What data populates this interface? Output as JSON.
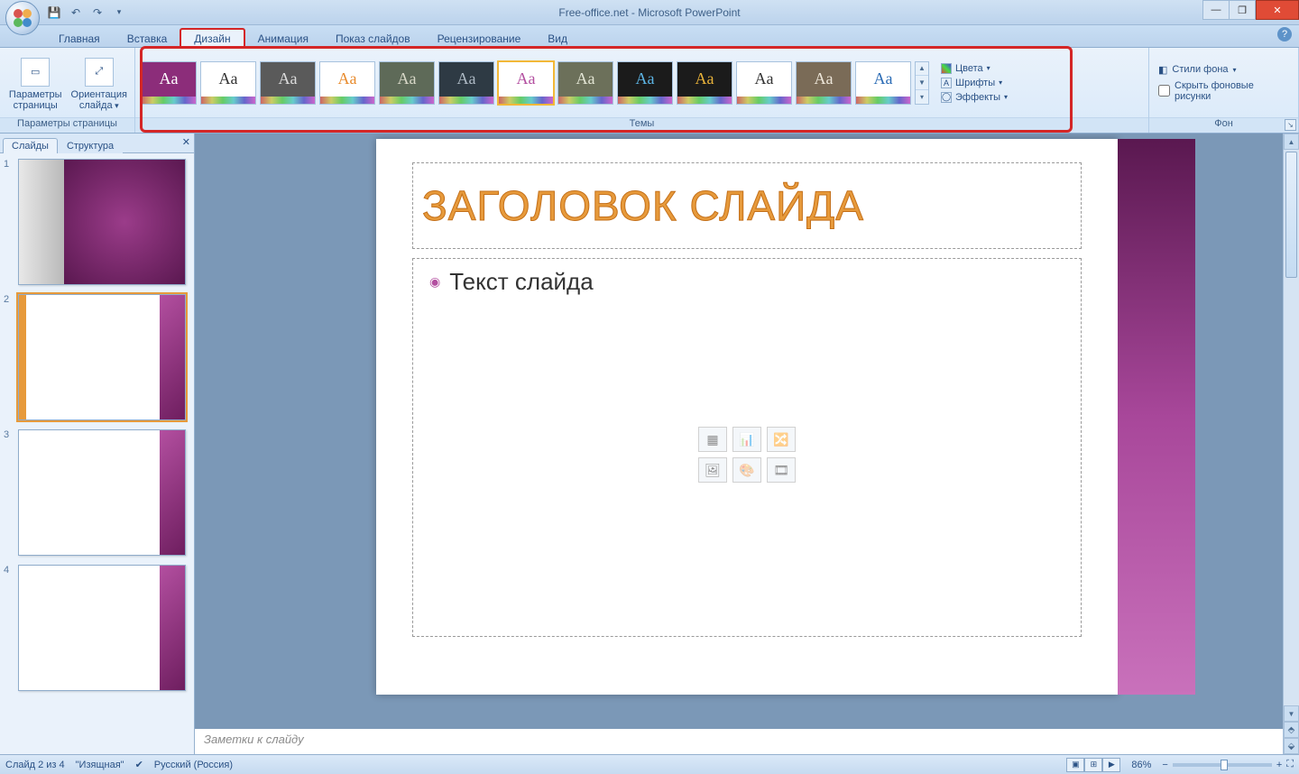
{
  "title": "Free-office.net - Microsoft PowerPoint",
  "tabs": {
    "items": [
      "Главная",
      "Вставка",
      "Дизайн",
      "Анимация",
      "Показ слайдов",
      "Рецензирование",
      "Вид"
    ],
    "active": "Дизайн"
  },
  "ribbon": {
    "page_setup_group": "Параметры страницы",
    "page_setup_btn": "Параметры страницы",
    "orientation_btn": "Ориентация слайда",
    "themes_group": "Темы",
    "colors": "Цвета",
    "fonts": "Шрифты",
    "effects": "Эффекты",
    "bg_group": "Фон",
    "bg_styles": "Стили фона",
    "hide_bg": "Скрыть фоновые рисунки",
    "theme_list": [
      {
        "bg": "#8c2d7a",
        "fg": "#ffffff"
      },
      {
        "bg": "#ffffff",
        "fg": "#333333"
      },
      {
        "bg": "#5a5a5a",
        "fg": "#dddddd"
      },
      {
        "bg": "#ffffff",
        "fg": "#e88b2e"
      },
      {
        "bg": "#5e6a58",
        "fg": "#d8d8c8"
      },
      {
        "bg": "#2e3a44",
        "fg": "#aebac5"
      },
      {
        "bg": "#ffffff",
        "fg": "#b34fa0"
      },
      {
        "bg": "#6c705a",
        "fg": "#e3e5d4"
      },
      {
        "bg": "#1b1b1b",
        "fg": "#5cb4e4"
      },
      {
        "bg": "#1b1b1b",
        "fg": "#e8b23a"
      },
      {
        "bg": "#ffffff",
        "fg": "#333333"
      },
      {
        "bg": "#7a6b57",
        "fg": "#eee7da"
      },
      {
        "bg": "#ffffff",
        "fg": "#2a6bb5"
      }
    ],
    "selected_theme_index": 6
  },
  "left_pane": {
    "tab_slides": "Слайды",
    "tab_outline": "Структура",
    "count": 4,
    "selected": 2
  },
  "slide": {
    "title": "ЗАГОЛОВОК СЛАЙДА",
    "body": "Текст слайда"
  },
  "notes_placeholder": "Заметки к слайду",
  "status": {
    "slide_info": "Слайд 2 из 4",
    "theme_name": "\"Изящная\"",
    "lang": "Русский (Россия)",
    "zoom": "86%"
  }
}
